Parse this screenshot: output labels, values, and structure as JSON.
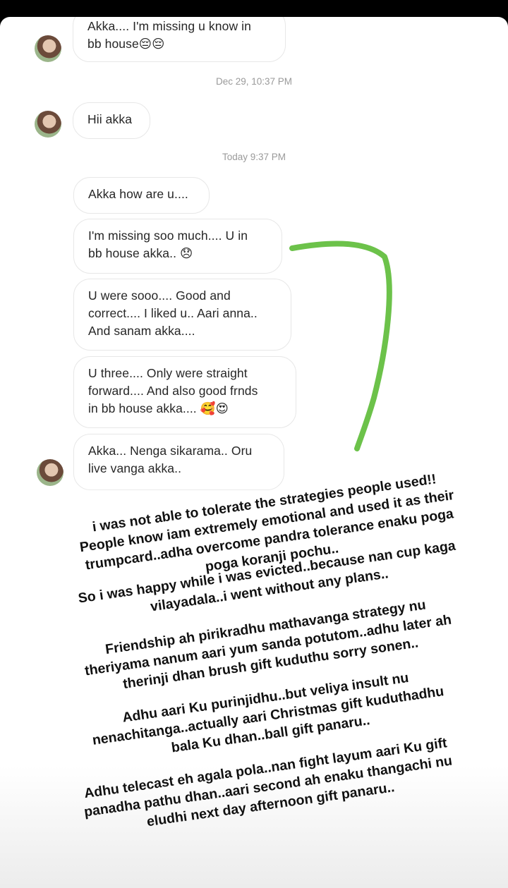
{
  "thread": {
    "messages_top": {
      "m1": {
        "lines": [
          "Akka.... I'm missing u know in",
          "bb house😔😔"
        ]
      },
      "ts1": "Dec 29, 10:37 PM",
      "m2": {
        "lines": [
          "Hii akka"
        ]
      },
      "ts2": "Today 9:37 PM",
      "m3": {
        "lines": [
          "Akka how are u...."
        ]
      },
      "m4": {
        "lines": [
          "I'm missing soo much.... U in",
          "bb house akka.. 😞"
        ]
      },
      "m5": {
        "lines": [
          "U were sooo.... Good and",
          "correct.... I liked u.. Aari anna..",
          "And sanam akka...."
        ]
      },
      "m6": {
        "lines": [
          "U three.... Only were straight",
          "forward.... And also good frnds",
          "in bb house akka.... 🥰😍"
        ]
      },
      "m7": {
        "lines": [
          "Akka... Nenga sikarama.. Oru",
          "live vanga akka.."
        ]
      }
    }
  },
  "caption": {
    "p1": [
      "i was not able to tolerate the strategies people used!!",
      "People know iam extremely emotional and used it as their",
      "trumpcard..adha overcome pandra tolerance enaku poga",
      "poga koranji pochu.."
    ],
    "p2": [
      "So i was happy while i was evicted..because nan cup kaga",
      "vilayadala..i went without any plans.."
    ],
    "p3": [
      "Friendship ah pirikradhu  mathavanga strategy nu",
      "theriyama nanum aari yum sanda  potutom..adhu later ah",
      "therinji dhan brush gift kuduthu sorry sonen.."
    ],
    "p4": [
      "Adhu aari Ku purinjidhu..but veliya insult nu",
      "nenachitanga..actually aari Christmas gift kuduthadhu",
      "bala Ku dhan..ball gift panaru.."
    ],
    "p5": [
      "Adhu telecast eh agala pola..nan fight layum aari Ku gift",
      "panadha pathu dhan..aari second ah enaku thangachi nu",
      "eludhi next day afternoon gift panaru.."
    ]
  },
  "colors": {
    "arrow": "#6cc24a",
    "bubble_border": "#e7e7e7",
    "timestamp": "#9a9a9a"
  }
}
